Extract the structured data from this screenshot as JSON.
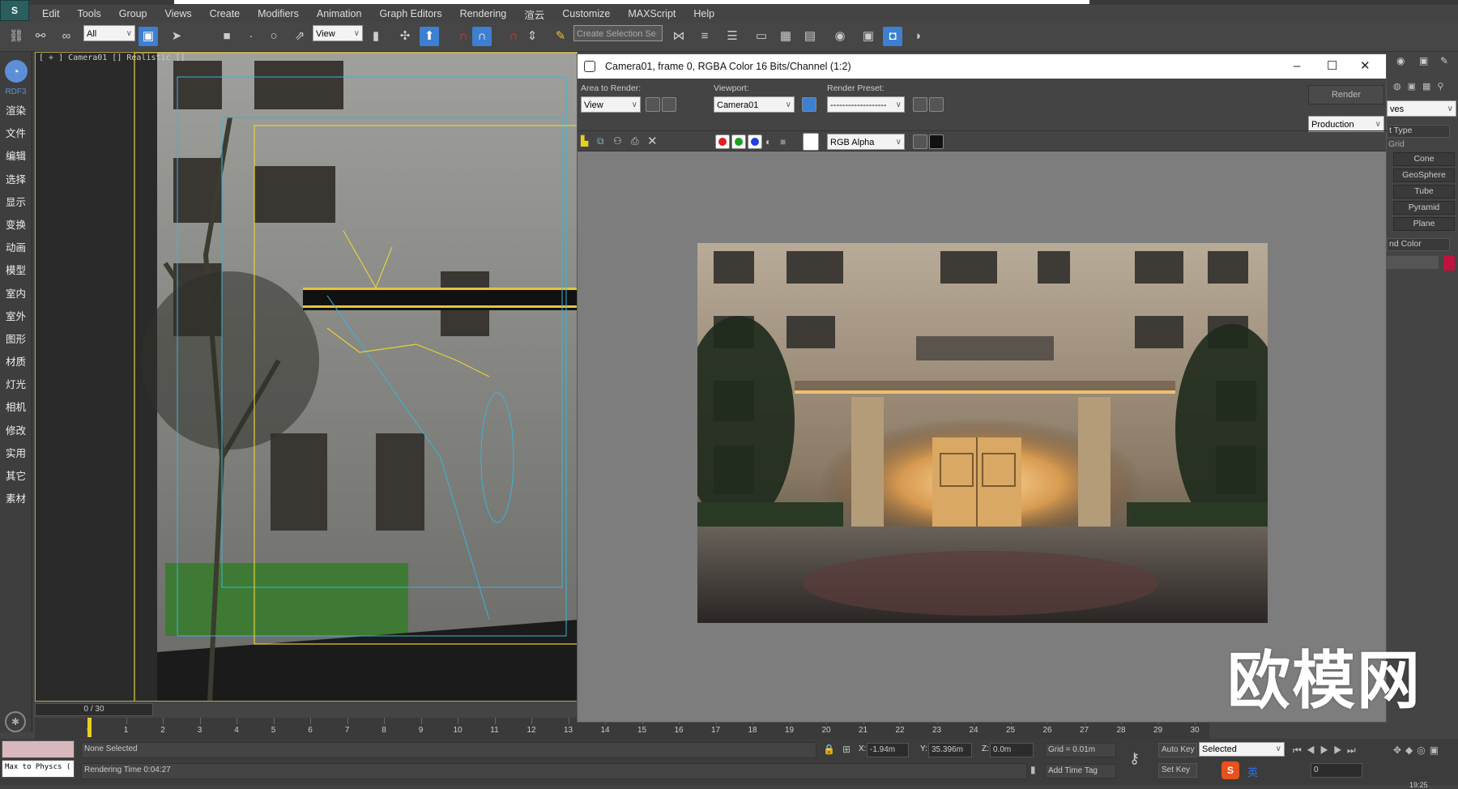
{
  "menu": [
    "Edit",
    "Tools",
    "Group",
    "Views",
    "Create",
    "Modifiers",
    "Animation",
    "Graph Editors",
    "Rendering",
    "渲云",
    "Customize",
    "MAXScript",
    "Help"
  ],
  "toolbar": {
    "selection_filter": "All",
    "ref_coord": "View",
    "named_selection_placeholder": "Create Selection Se"
  },
  "sidebar": {
    "brand": "RDF3",
    "items": [
      "渲染",
      "文件",
      "编辑",
      "选择",
      "显示",
      "变换",
      "动画",
      "模型",
      "室内",
      "室外",
      "图形",
      "材质",
      "灯光",
      "相机",
      "修改",
      "实用",
      "其它",
      "素材"
    ]
  },
  "viewport": {
    "label": "[ + ] Camera01 [] Realistic []",
    "slider": "0 / 30"
  },
  "render_window": {
    "title": "Camera01, frame 0, RGBA Color 16 Bits/Channel (1:2)",
    "area_label": "Area to Render:",
    "area_value": "View",
    "viewport_label": "Viewport:",
    "viewport_value": "Camera01",
    "preset_label": "Render Preset:",
    "preset_value": "-------------------",
    "render_button": "Render",
    "mode_value": "Production",
    "channel_value": "RGB Alpha",
    "accent_colors": {
      "red": "#e02020",
      "green": "#20a020",
      "blue": "#2040e0"
    }
  },
  "command_panel": {
    "dropdown": "ves",
    "rollout_object_type": "t Type",
    "grid_label": "Grid",
    "buttons": [
      "Cone",
      "GeoSphere",
      "Tube",
      "Pyramid",
      "Plane"
    ],
    "rollout_color": "nd Color",
    "swatch_color": "#c0123c"
  },
  "timeline": {
    "ticks": [
      0,
      1,
      2,
      3,
      4,
      5,
      6,
      7,
      8,
      9,
      10,
      11,
      12,
      13,
      14,
      15,
      16,
      17,
      18,
      19,
      20,
      21,
      22,
      23,
      24,
      25,
      26,
      27,
      28,
      29,
      30
    ]
  },
  "status": {
    "script_listener": "Max to Physcs (",
    "selection": "None Selected",
    "prompt": "Rendering Time  0:04:27",
    "x": "-1.94m",
    "y": "35.396m",
    "z": "0.0m",
    "grid": "Grid = 0.01m",
    "add_time_tag": "Add Time Tag",
    "auto_key": "Auto Key",
    "set_key": "Set Key",
    "key_filter": "Selected",
    "frame": "0",
    "clock": "19:25",
    "x_label": "X:",
    "y_label": "Y:",
    "z_label": "Z:"
  },
  "watermark": "欧模网"
}
